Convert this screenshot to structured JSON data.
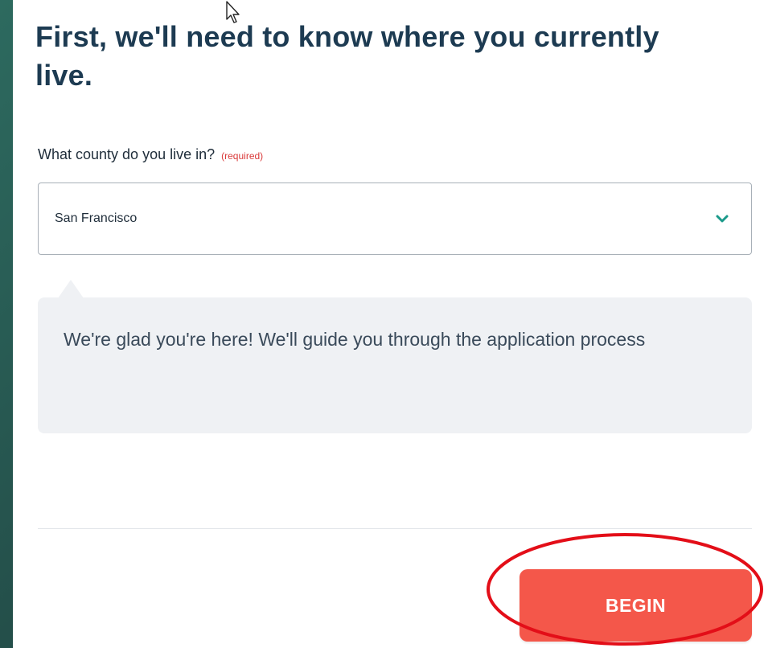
{
  "page": {
    "heading": "First, we'll need to know where you currently live."
  },
  "county_field": {
    "label": "What county do you live in?",
    "required_text": "(required)",
    "selected_value": "San Francisco"
  },
  "callout": {
    "message": "We're glad you're here! We'll guide you through the application process"
  },
  "actions": {
    "begin_label": "BEGIN"
  },
  "icons": {
    "select_chevron": "chevron-down-icon",
    "cursor": "mouse-pointer-icon",
    "annotation": "red-ellipse-highlight"
  },
  "colors": {
    "heading": "#1d3b52",
    "accent_teal": "#1a9a8a",
    "button_red": "#f4574a",
    "required_red": "#d93a3a",
    "callout_bg": "#eff1f4",
    "annotation_red": "#e30e18"
  }
}
